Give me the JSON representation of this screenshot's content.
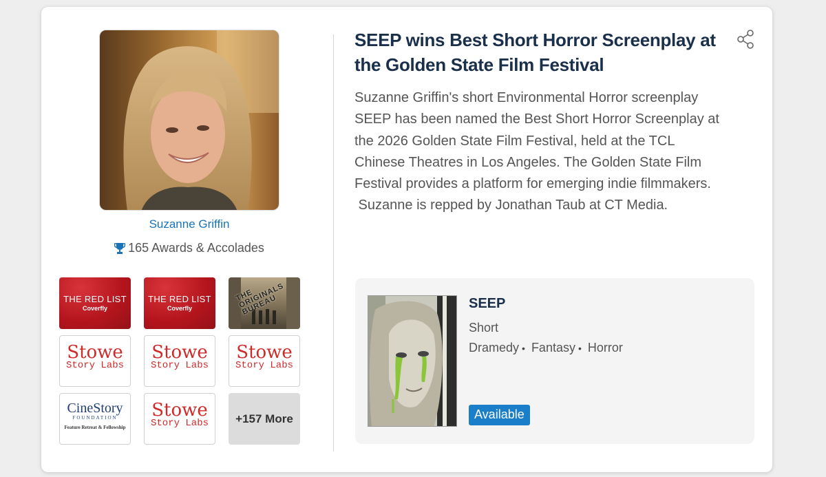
{
  "author": {
    "name": "Suzanne Griffin",
    "awards_text": "165 Awards & Accolades",
    "photo_icon": "author-portrait"
  },
  "badges": [
    {
      "kind": "red-list",
      "line1": "THE RED LIST",
      "line2": "Coverfly"
    },
    {
      "kind": "red-list",
      "line1": "THE RED LIST",
      "line2": "Coverfly"
    },
    {
      "kind": "photo",
      "line1": "THE ORIGINALS BUREAU"
    },
    {
      "kind": "stowe",
      "line1": "Stowe",
      "line2": "Story Labs"
    },
    {
      "kind": "stowe",
      "line1": "Stowe",
      "line2": "Story Labs"
    },
    {
      "kind": "stowe",
      "line1": "Stowe",
      "line2": "Story Labs"
    },
    {
      "kind": "cinestory",
      "line1": "CineStory",
      "line2": "FOUNDATION",
      "line3": "Feature Retreat & Fellowship"
    },
    {
      "kind": "stowe",
      "line1": "Stowe",
      "line2": "Story Labs"
    },
    {
      "kind": "more",
      "line1": "+157 More"
    }
  ],
  "article": {
    "headline_line1": "SEEP wins Best Short Horror Screenplay at",
    "headline_line2": "the Golden State Film Festival",
    "body_lines": [
      "Suzanne Griffin's short Environmental Horror screenplay",
      "SEEP has been named the Best Short Horror Screenplay at",
      "the 2026 Golden State Film Festival, held at the TCL",
      "Chinese Theatres in Los Angeles.  The Golden State Film",
      "Festival provides a platform for emerging indie filmmakers.",
      " Suzanne is repped by Jonathan Taub at CT Media."
    ],
    "share_icon": "share-icon"
  },
  "project": {
    "title": "SEEP",
    "type": "Short",
    "genres": [
      "Dramedy",
      "Fantasy",
      "Horror"
    ],
    "genre_separator": "•",
    "status": "Available"
  },
  "colors": {
    "link": "#1a73b8",
    "headline": "#1a2f4a",
    "status_badge": "#1a7fc8",
    "trophy": "#1a73b8"
  }
}
